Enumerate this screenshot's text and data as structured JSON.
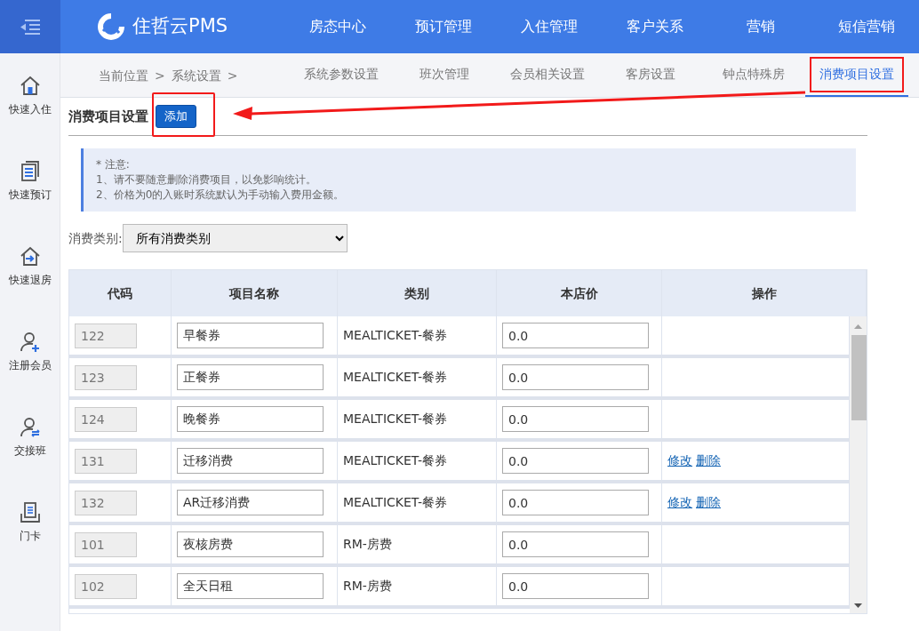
{
  "brand": {
    "name": "住哲云PMS"
  },
  "top_nav": [
    {
      "label": "房态中心"
    },
    {
      "label": "预订管理"
    },
    {
      "label": "入住管理"
    },
    {
      "label": "客户关系"
    },
    {
      "label": "营销"
    },
    {
      "label": "短信营销"
    }
  ],
  "sidebar": {
    "items": [
      {
        "label": "快速入住",
        "kind": "checkin"
      },
      {
        "label": "快速预订",
        "kind": "booking"
      },
      {
        "label": "快速退房",
        "kind": "checkout"
      },
      {
        "label": "注册会员",
        "kind": "member"
      },
      {
        "label": "交接班",
        "kind": "shift"
      },
      {
        "label": "门卡",
        "kind": "card"
      }
    ]
  },
  "breadcrumb": [
    "当前位置",
    ">",
    "系统设置",
    ">"
  ],
  "tabs": [
    {
      "label": "系统参数设置",
      "selected": false,
      "annotated": false
    },
    {
      "label": "班次管理",
      "selected": false,
      "annotated": false
    },
    {
      "label": "会员相关设置",
      "selected": false,
      "annotated": false
    },
    {
      "label": "客房设置",
      "selected": false,
      "annotated": false
    },
    {
      "label": "钟点特殊房",
      "selected": false,
      "annotated": false
    },
    {
      "label": "消费项目设置",
      "selected": true,
      "annotated": true
    }
  ],
  "page_title": "消费项目设置",
  "add_button": {
    "label": "添加",
    "annotated": true
  },
  "notice": [
    "* 注意:",
    "1、请不要随意删除消费项目，以免影响统计。",
    "2、价格为0的入账时系统默认为手动输入费用金额。"
  ],
  "filter": {
    "label": "消费类别:",
    "value": "所有消费类别"
  },
  "table": {
    "columns": [
      "代码",
      "项目名称",
      "类别",
      "本店价",
      "操作"
    ],
    "rows": [
      {
        "code": "122",
        "name": "早餐券",
        "category": "MEALTICKET-餐券",
        "price": "0.0",
        "actions": []
      },
      {
        "code": "123",
        "name": "正餐券",
        "category": "MEALTICKET-餐券",
        "price": "0.0",
        "actions": []
      },
      {
        "code": "124",
        "name": "晚餐券",
        "category": "MEALTICKET-餐券",
        "price": "0.0",
        "actions": []
      },
      {
        "code": "131",
        "name": "迁移消费",
        "category": "MEALTICKET-餐券",
        "price": "0.0",
        "actions": [
          "修改",
          "删除"
        ]
      },
      {
        "code": "132",
        "name": "AR迁移消费",
        "category": "MEALTICKET-餐券",
        "price": "0.0",
        "actions": [
          "修改",
          "删除"
        ]
      },
      {
        "code": "101",
        "name": "夜核房费",
        "category": "RM-房费",
        "price": "0.0",
        "actions": []
      },
      {
        "code": "102",
        "name": "全天日租",
        "category": "RM-房费",
        "price": "0.0",
        "actions": []
      }
    ]
  }
}
